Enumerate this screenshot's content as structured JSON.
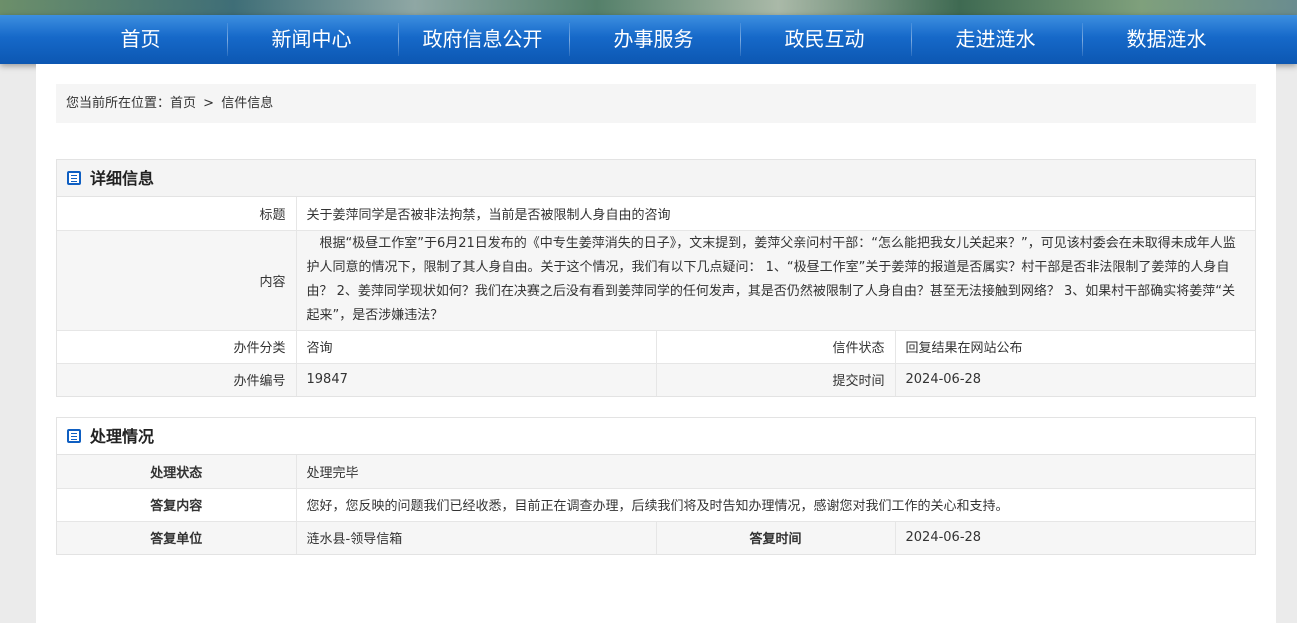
{
  "nav": {
    "items": [
      "首页",
      "新闻中心",
      "政府信息公开",
      "办事服务",
      "政民互动",
      "走进涟水",
      "数据涟水"
    ]
  },
  "breadcrumb": {
    "prefix": "您当前所在位置：",
    "home": "首页",
    "sep": ">",
    "current": "信件信息"
  },
  "detail": {
    "title": "详细信息",
    "subject_label": "标题",
    "subject": "关于姜萍同学是否被非法拘禁，当前是否被限制人身自由的咨询",
    "content_label": "内容",
    "content": "根据“极昼工作室”于6月21日发布的《中专生姜萍消失的日子》，文末提到，姜萍父亲问村干部：“怎么能把我女儿关起来？”，可见该村委会在未取得未成年人监护人同意的情况下，限制了其人身自由。关于这个情况，我们有以下几点疑问： 1、“极昼工作室”关于姜萍的报道是否属实？村干部是否非法限制了姜萍的人身自由？ 2、姜萍同学现状如何？我们在决赛之后没有看到姜萍同学的任何发声，其是否仍然被限制了人身自由？甚至无法接触到网络？ 3、如果村干部确实将姜萍“关起来”，是否涉嫌违法？",
    "category_label": "办件分类",
    "category": "咨询",
    "status_label": "信件状态",
    "status": "回复结果在网站公布",
    "number_label": "办件编号",
    "number": "19847",
    "submit_label": "提交时间",
    "submit_time": "2024-06-28"
  },
  "handling": {
    "title": "处理情况",
    "state_label": "处理状态",
    "state": "处理完毕",
    "reply_label": "答复内容",
    "reply": "您好，您反映的问题我们已经收悉，目前正在调查办理，后续我们将及时告知办理情况，感谢您对我们工作的关心和支持。",
    "unit_label": "答复单位",
    "unit": "涟水县-领导信箱",
    "reply_time_label": "答复时间",
    "reply_time": "2024-06-28"
  },
  "colors": {
    "nav": "#1669c9",
    "accent_icon": "#0f5fc2"
  }
}
